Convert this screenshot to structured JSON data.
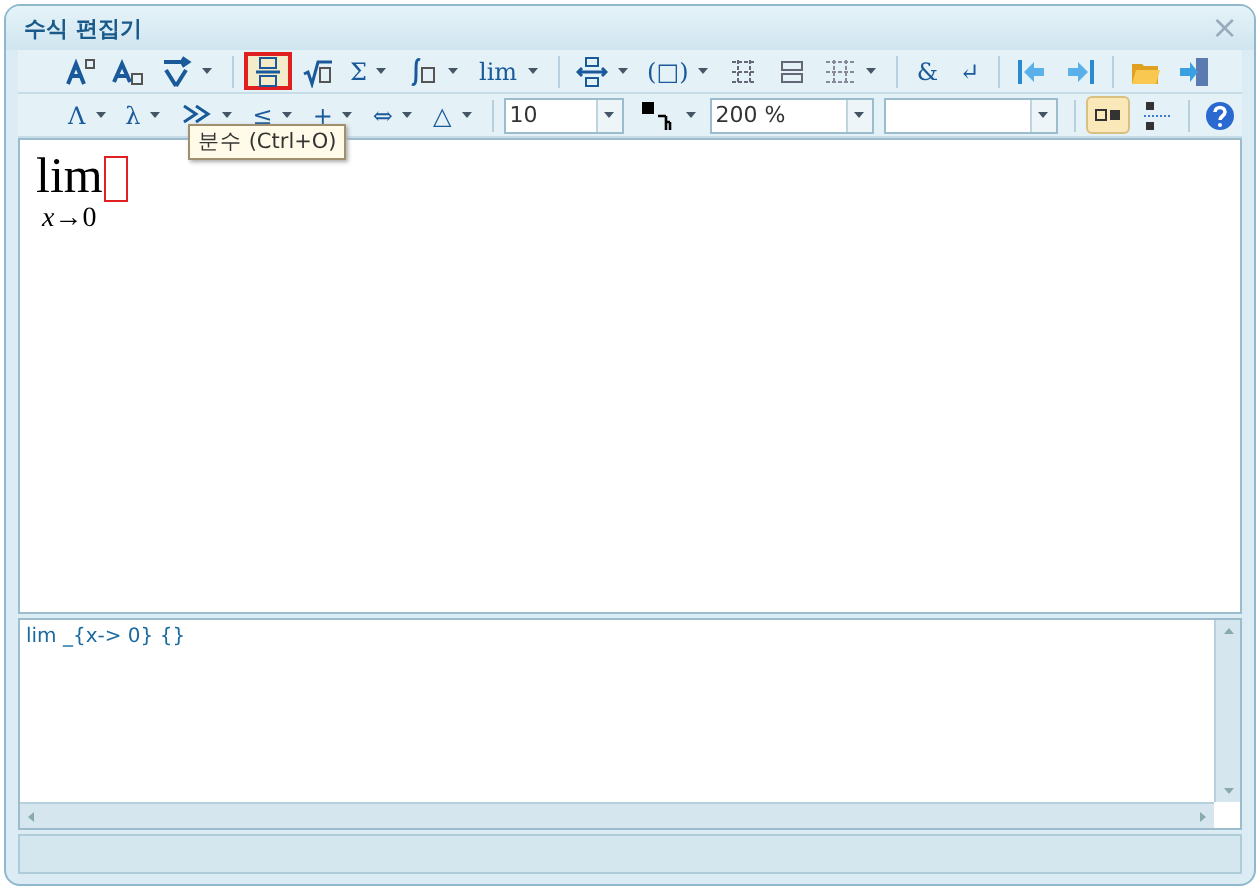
{
  "window": {
    "title": "수식 편집기",
    "close": "×"
  },
  "toolbar_1": [
    {
      "dropdown": false,
      "selected": false
    },
    {
      "dropdown": false,
      "selected": false
    },
    {
      "dropdown": true,
      "selected": false
    },
    {
      "dropdown": false,
      "selected": true
    },
    {
      "dropdown": false,
      "selected": false
    },
    {
      "glyph": "Σ",
      "dropdown": true,
      "selected": false
    },
    {
      "dropdown": true,
      "selected": false
    },
    {
      "glyph": "lim",
      "dropdown": true,
      "selected": false
    },
    {
      "dropdown": true,
      "selected": false
    },
    {
      "glyph": "(□)",
      "dropdown": true,
      "selected": false
    },
    {
      "dropdown": false,
      "selected": false
    },
    {
      "dropdown": false,
      "selected": false
    },
    {
      "dropdown": true,
      "selected": false
    },
    {
      "glyph": "&",
      "dropdown": false,
      "selected": false
    },
    {
      "glyph": "↵",
      "dropdown": false,
      "selected": false
    },
    {
      "dropdown": false,
      "selected": false
    },
    {
      "dropdown": false,
      "selected": false
    },
    {
      "dropdown": false,
      "selected": false
    },
    {
      "dropdown": false,
      "selected": false
    }
  ],
  "toolbar_2": {
    "buttons": [
      {
        "glyph": "Λ",
        "dropdown": true
      },
      {
        "glyph": "λ",
        "dropdown": true
      },
      {
        "dropdown": true
      },
      {
        "glyph": "≤",
        "dropdown": true
      },
      {
        "glyph": "+",
        "dropdown": true
      },
      {
        "glyph": "⇔",
        "dropdown": true
      },
      {
        "glyph": "△",
        "dropdown": true
      }
    ],
    "font_size": "10",
    "zoom": "200 %",
    "toggles": [
      {
        "on": true
      },
      {
        "on": false
      }
    ]
  },
  "tooltip": "분수 (Ctrl+O)",
  "editor": {
    "limit": "lim",
    "subscript_var": "x",
    "arrow": "→",
    "subscript_value": "0"
  },
  "source": "lim _{x-> 0} {}"
}
